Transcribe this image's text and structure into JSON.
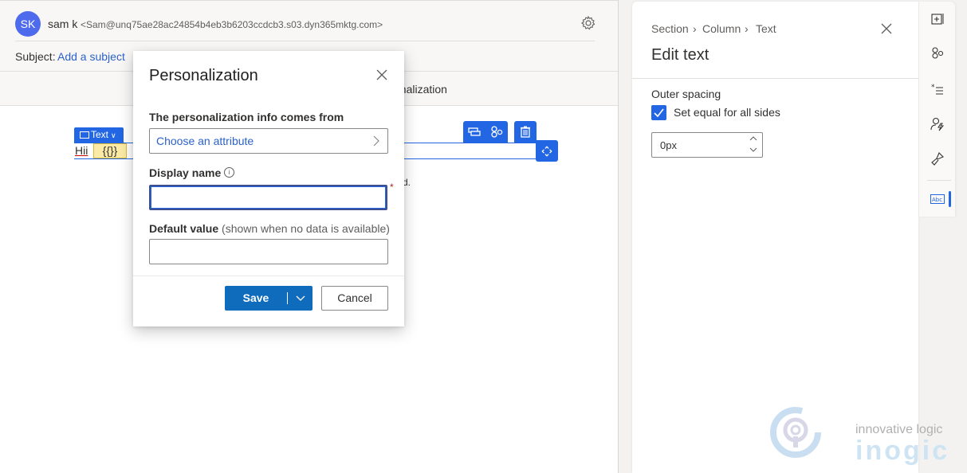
{
  "email_header": {
    "avatar_initials": "SK",
    "sender_name": "sam k",
    "sender_email": "<Sam@unq75ae28ac24854b4eb3b6203ccdcb3.s03.dyn365mktg.com>",
    "subject_label": "Subject:",
    "subject_placeholder": "Add a subject",
    "settings_icon": "gear-icon"
  },
  "tab_bar": {
    "visible_tab_fragment": "onalization"
  },
  "canvas": {
    "block_tag_label": "Text",
    "text_content": "Hii",
    "token_text": "{{}}",
    "partial_hint": "d.",
    "toolbar_icons": [
      "layout-icon",
      "personalization-icon",
      "delete-icon",
      "move-icon"
    ]
  },
  "dialog": {
    "title": "Personalization",
    "source_label": "The personalization info comes from",
    "source_placeholder": "Choose an attribute",
    "display_name_label": "Display name",
    "display_name_value": "",
    "required_marker": "*",
    "default_value_label": "Default value",
    "default_value_hint": "(shown when no data is available)",
    "default_value_value": "",
    "save_label": "Save",
    "cancel_label": "Cancel"
  },
  "panel": {
    "breadcrumb": [
      "Section",
      "Column",
      "Text"
    ],
    "title": "Edit text",
    "outer_spacing_label": "Outer spacing",
    "equal_sides_label": "Set equal for all sides",
    "equal_sides_checked": true,
    "spacing_value": "0px"
  },
  "rail": {
    "items": [
      "add-element-icon",
      "personalization-icon",
      "styles-list-icon",
      "dynamic-content-icon",
      "brush-icon",
      "text-properties-icon"
    ],
    "active": "text-properties-icon"
  },
  "watermark": {
    "line1": "innovative logic",
    "line2": "inogic"
  },
  "colors": {
    "accent": "#2266e3",
    "primary_button": "#0f6cbd",
    "link": "#2b62c9",
    "required": "#a4262c"
  }
}
